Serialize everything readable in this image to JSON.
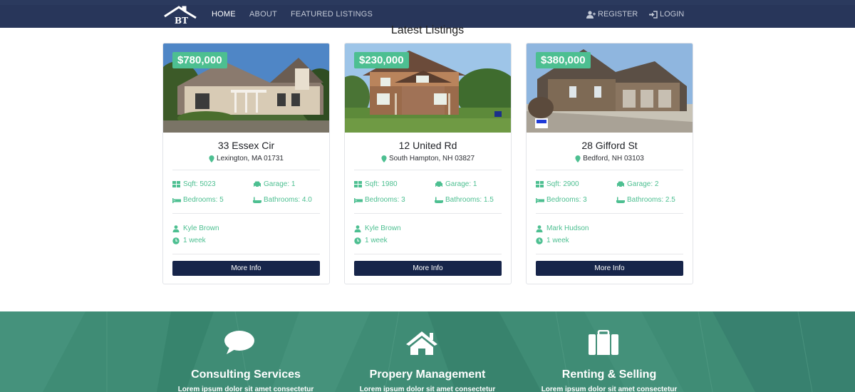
{
  "colors": {
    "nav": "#28365a",
    "accent": "#4dbf91",
    "button": "#17254a",
    "services_bg": "#3d8a73"
  },
  "nav": {
    "logo_text": "BT",
    "links": [
      "HOME",
      "ABOUT",
      "FEATURED LISTINGS"
    ],
    "register": "REGISTER",
    "login": "LOGIN",
    "register_icon": "user-plus-icon",
    "login_icon": "sign-in-icon"
  },
  "section_title": "Latest Listings",
  "listings": [
    {
      "price": "$780,000",
      "address": "33 Essex Cir",
      "location": "Lexington, MA 01731",
      "sqft": "Sqft: 5023",
      "garage": "Garage: 1",
      "bedrooms": "Bedrooms: 5",
      "bathrooms": "Bathrooms: 4.0",
      "agent": "Kyle Brown",
      "time": "1 week",
      "button": "More Info"
    },
    {
      "price": "$230,000",
      "address": "12 United Rd",
      "location": "South Hampton, NH 03827",
      "sqft": "Sqft: 1980",
      "garage": "Garage: 1",
      "bedrooms": "Bedrooms: 3",
      "bathrooms": "Bathrooms: 1.5",
      "agent": "Kyle Brown",
      "time": "1 week",
      "button": "More Info"
    },
    {
      "price": "$380,000",
      "address": "28 Gifford St",
      "location": "Bedford, NH 03103",
      "sqft": "Sqft: 2900",
      "garage": "Garage: 2",
      "bedrooms": "Bedrooms: 3",
      "bathrooms": "Bathrooms: 2.5",
      "agent": "Mark Hudson",
      "time": "1 week",
      "button": "More Info"
    }
  ],
  "services": [
    {
      "icon": "comment-icon",
      "title": "Consulting Services",
      "text": "Lorem ipsum dolor sit amet consectetur"
    },
    {
      "icon": "home-icon",
      "title": "Propery Management",
      "text": "Lorem ipsum dolor sit amet consectetur"
    },
    {
      "icon": "suitcase-icon",
      "title": "Renting & Selling",
      "text": "Lorem ipsum dolor sit amet consectetur"
    }
  ]
}
